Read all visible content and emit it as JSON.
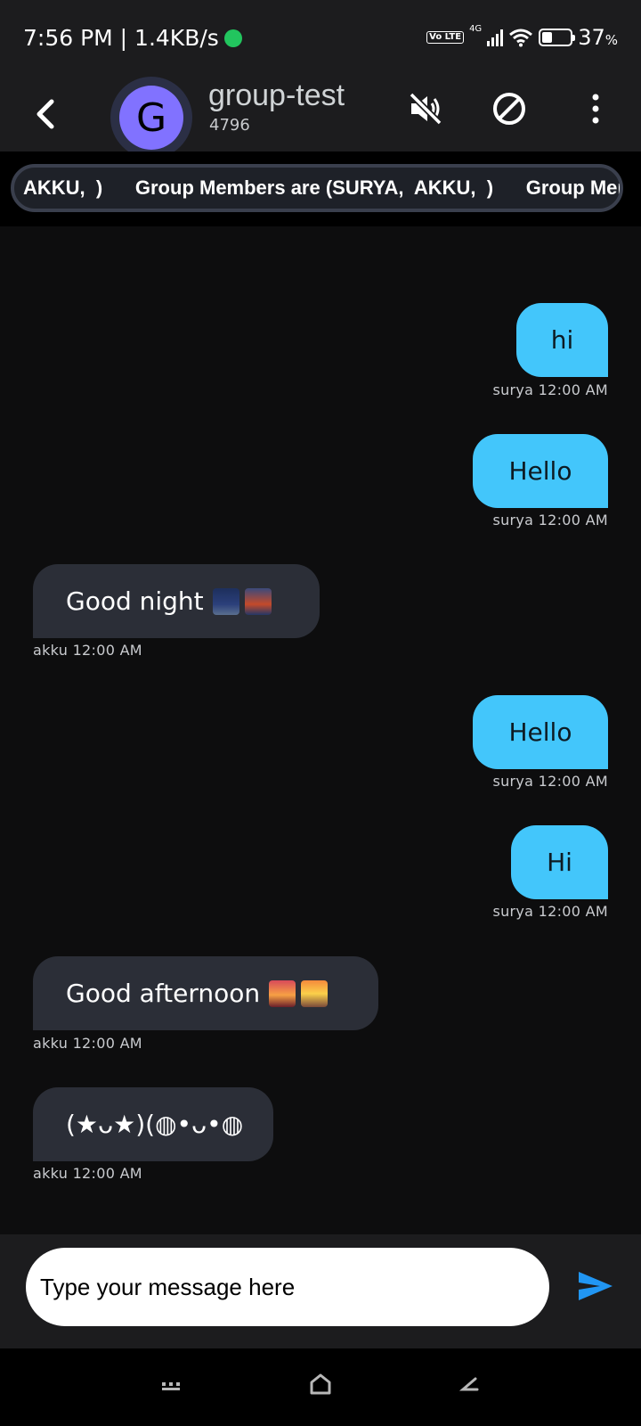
{
  "status_bar": {
    "time_speed": "7:56 PM | 1.4KB/s",
    "network_badge": "Vo LTE",
    "network_type": "4G",
    "battery_percent": "37",
    "battery_unit": "%",
    "battery_level": 0.37
  },
  "header": {
    "avatar_letter": "G",
    "group_name": "group-test",
    "group_code": "4796",
    "icons": [
      "back-icon",
      "mute-icon",
      "block-icon",
      "more-vert-icon"
    ]
  },
  "marquee": {
    "text": "AKKU,  )      Group Members are (SURYA,  AKKU,  )      Group Mem"
  },
  "messages": [
    {
      "sender_side": "outgoing",
      "text": "hi",
      "meta": "surya 12:00 AM"
    },
    {
      "sender_side": "outgoing",
      "text": "Hello",
      "meta": "surya 12:00 AM"
    },
    {
      "sender_side": "incoming",
      "text": "Good night",
      "emoji": [
        "night-city-emoji",
        "bridge-at-night-emoji"
      ],
      "meta": "akku 12:00 AM"
    },
    {
      "sender_side": "outgoing",
      "text": "Hello",
      "meta": "surya 12:00 AM"
    },
    {
      "sender_side": "outgoing",
      "text": "Hi",
      "meta": "surya 12:00 AM"
    },
    {
      "sender_side": "incoming",
      "text": "Good afternoon",
      "emoji": [
        "city-sunset-emoji",
        "sunrise-over-mountains-emoji"
      ],
      "meta": "akku 12:00 AM"
    },
    {
      "sender_side": "incoming",
      "text": "(★ᴗ★)(◍•ᴗ•◍",
      "meta": "akku 12:00 AM"
    }
  ],
  "composer": {
    "placeholder": "Type your message here",
    "send_icon": "send-icon"
  },
  "nav_bar": {
    "icons": [
      "recents-icon",
      "home-icon",
      "back-nav-icon"
    ]
  },
  "colors": {
    "outgoing_bubble": "#43c6fb",
    "incoming_bubble": "#2b2e37",
    "avatar": "#8172ff",
    "send": "#2196f3"
  }
}
